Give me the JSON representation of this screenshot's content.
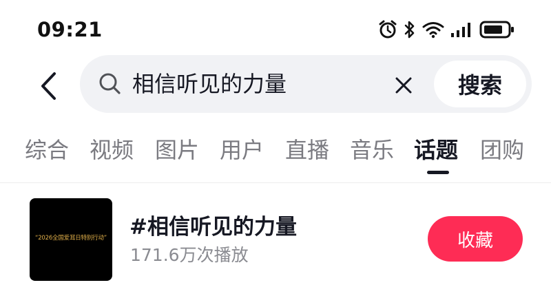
{
  "status_bar": {
    "time": "09:21",
    "icons": [
      "alarm-icon",
      "bluetooth-icon",
      "wifi-icon",
      "signal-icon",
      "battery-icon"
    ]
  },
  "search": {
    "query": "相信听见的力量",
    "button_label": "搜索"
  },
  "tabs": [
    {
      "label": "综合",
      "active": false
    },
    {
      "label": "视频",
      "active": false
    },
    {
      "label": "图片",
      "active": false
    },
    {
      "label": "用户",
      "active": false
    },
    {
      "label": "直播",
      "active": false
    },
    {
      "label": "音乐",
      "active": false
    },
    {
      "label": "话题",
      "active": true
    },
    {
      "label": "团购",
      "active": false
    }
  ],
  "result": {
    "thumbnail_caption": "“2026全国爱耳日特别行动”",
    "title": "#相信听见的力量",
    "plays": "171.6万次播放",
    "collect_label": "收藏"
  },
  "colors": {
    "accent": "#fe2c55",
    "search_bg": "#f1f2f5",
    "thumb_caption": "#e2b04a"
  }
}
